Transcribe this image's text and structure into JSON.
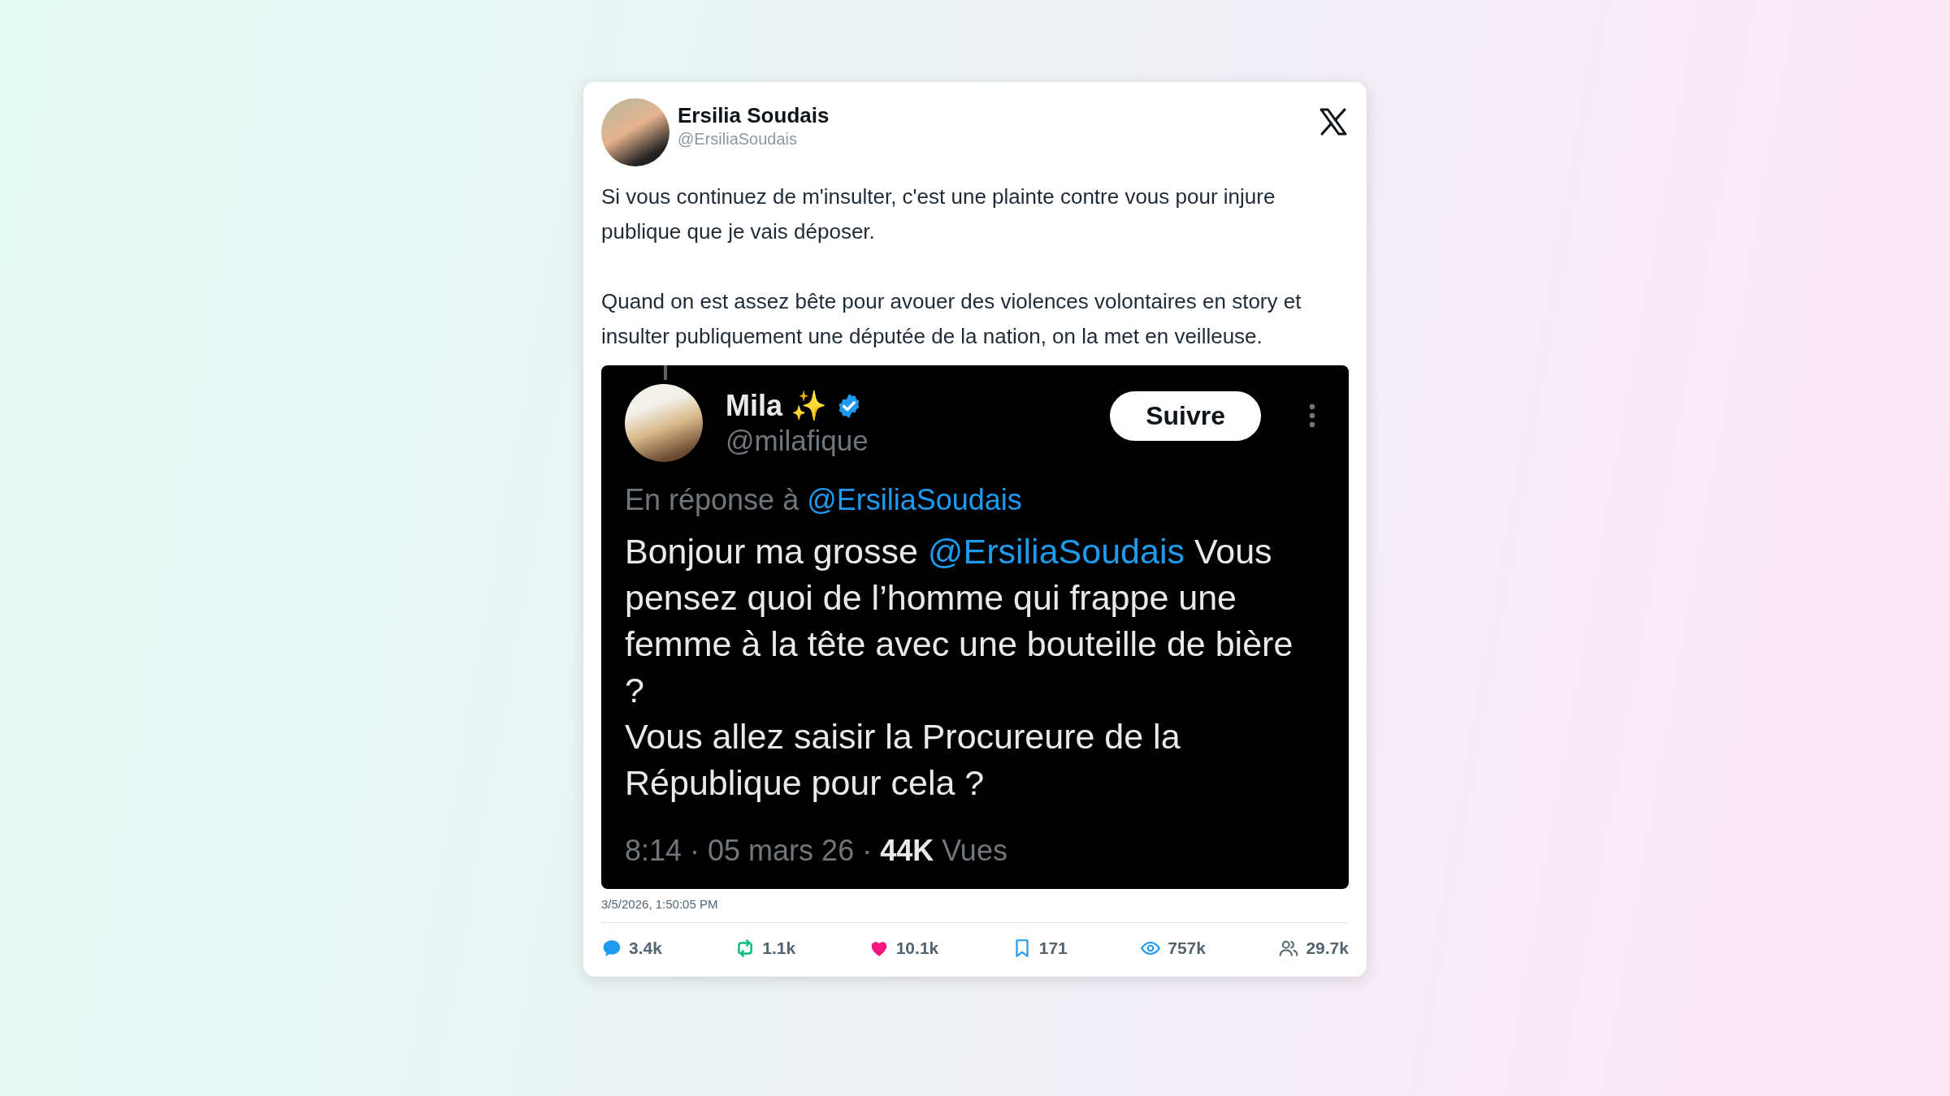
{
  "author": {
    "name": "Ersilia Soudais",
    "handle": "@ErsiliaSoudais"
  },
  "text": [
    "Si vous continuez de m'insulter, c'est une plainte contre vous pour injure publique que je vais déposer.",
    "Quand on est assez bête pour avouer des violences volontaires en story et insulter publiquement une députée de la nation, on la met en veilleuse."
  ],
  "quoted_screenshot": {
    "name": "Mila ✨",
    "verified": true,
    "handle": "@milafique",
    "follow_button": "Suivre",
    "reply_prefix": "En réponse à",
    "reply_handle": "@ErsiliaSoudais",
    "body": [
      {
        "kind": "plain",
        "text": "Bonjour ma grosse "
      },
      {
        "kind": "mention",
        "text": "@ErsiliaSoudais"
      },
      {
        "kind": "plain",
        "text": " Vous pensez quoi de l’homme qui frappe une femme à la tête avec une bouteille de bière ?\nVous allez saisir la Procureure de la République pour cela ?"
      }
    ],
    "meta": "8:14 · 05 mars 26 · **44K** Vues"
  },
  "timestamp": "3/5/2026, 1:50:05 PM",
  "stats": [
    {
      "kind": "replies",
      "value": "3.4k"
    },
    {
      "kind": "reposts",
      "value": "1.1k"
    },
    {
      "kind": "likes",
      "value": "10.1k"
    },
    {
      "kind": "bookmarks",
      "value": "171"
    },
    {
      "kind": "views",
      "value": "757k"
    },
    {
      "kind": "followers",
      "value": "29.7k"
    }
  ]
}
